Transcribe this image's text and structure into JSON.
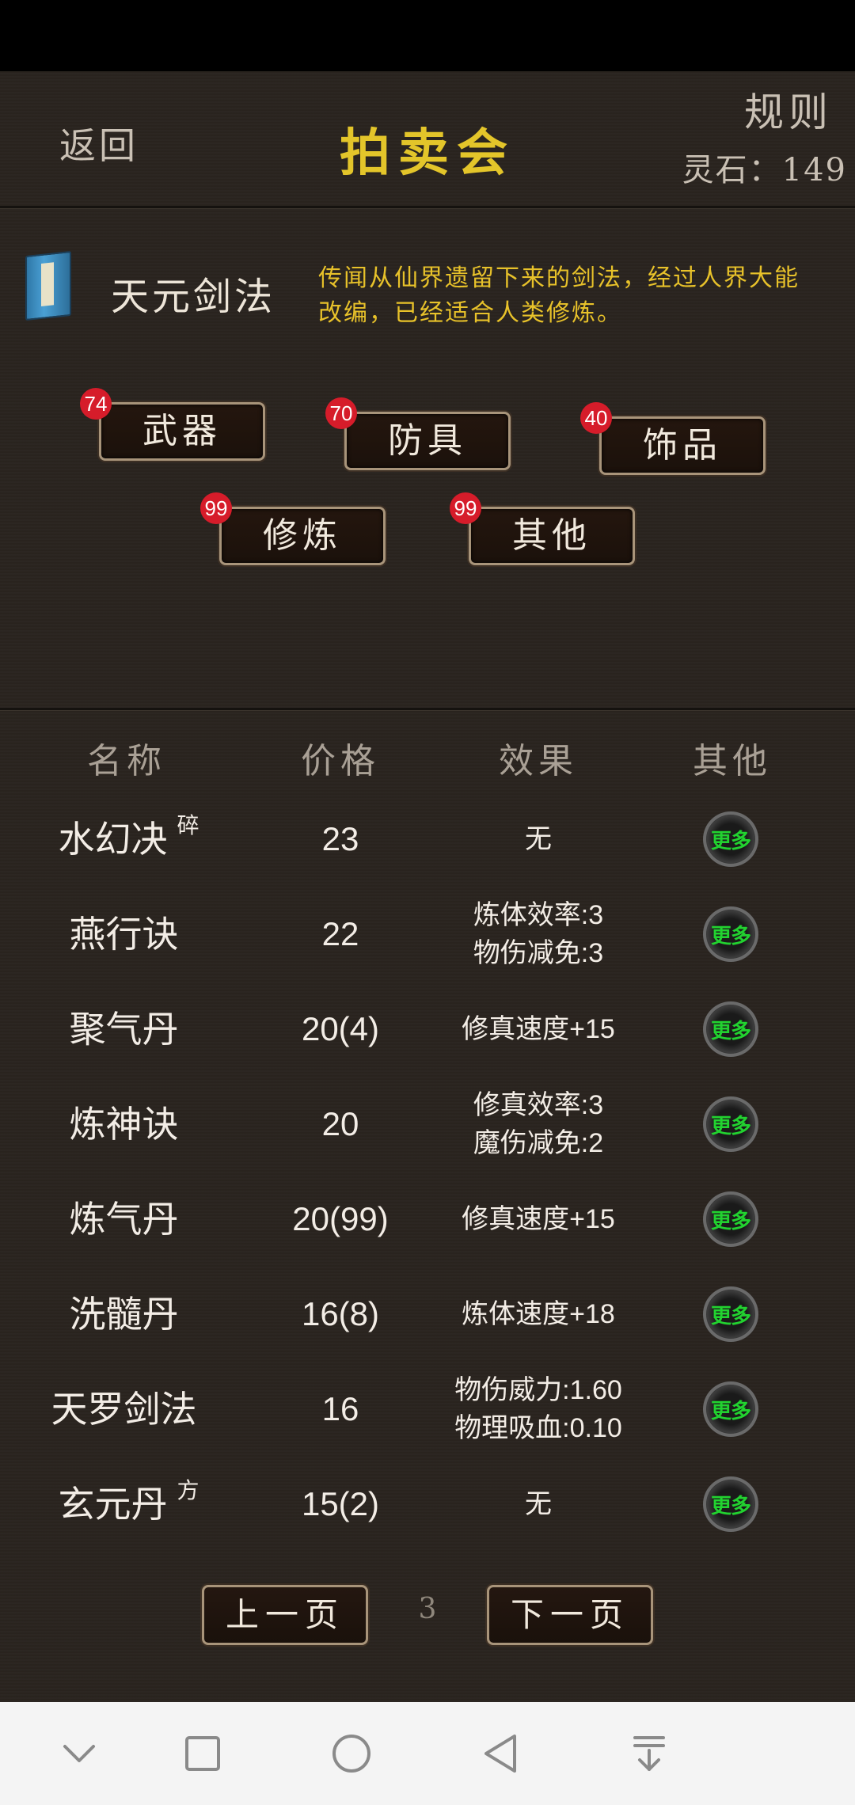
{
  "header": {
    "back_label": "返回",
    "title": "拍卖会",
    "rules_label": "规则",
    "spirit_stones": "灵石：149"
  },
  "featured": {
    "name": "天元剑法",
    "description": "传闻从仙界遗留下来的剑法，经过人界大能改编，已经适合人类修炼。"
  },
  "categories": [
    {
      "label": "武器",
      "count": "74"
    },
    {
      "label": "防具",
      "count": "70"
    },
    {
      "label": "饰品",
      "count": "40"
    },
    {
      "label": "修炼",
      "count": "99"
    },
    {
      "label": "其他",
      "count": "99"
    }
  ],
  "table": {
    "headers": {
      "name": "名称",
      "price": "价格",
      "effect": "效果",
      "other": "其他"
    },
    "more_label": "更多",
    "rows": [
      {
        "name": "水幻决",
        "tag": "碎",
        "price": "23",
        "effect1": "无",
        "effect2": ""
      },
      {
        "name": "燕行诀",
        "tag": "",
        "price": "22",
        "effect1": "炼体效率:3",
        "effect2": "物伤减免:3"
      },
      {
        "name": "聚气丹",
        "tag": "",
        "price": "20(4)",
        "effect1": "修真速度+15",
        "effect2": ""
      },
      {
        "name": "炼神诀",
        "tag": "",
        "price": "20",
        "effect1": "修真效率:3",
        "effect2": "魔伤减免:2"
      },
      {
        "name": "炼气丹",
        "tag": "",
        "price": "20(99)",
        "effect1": "修真速度+15",
        "effect2": ""
      },
      {
        "name": "洗髓丹",
        "tag": "",
        "price": "16(8)",
        "effect1": "炼体速度+18",
        "effect2": ""
      },
      {
        "name": "天罗剑法",
        "tag": "",
        "price": "16",
        "effect1": "物伤威力:1.60",
        "effect2": "物理吸血:0.10"
      },
      {
        "name": "玄元丹",
        "tag": "方",
        "price": "15(2)",
        "effect1": "无",
        "effect2": ""
      }
    ]
  },
  "pager": {
    "prev_label": "上一页",
    "page": "3",
    "next_label": "下一页"
  },
  "colors": {
    "background": "#2a241f",
    "title": "#e3c52a",
    "description": "#e8c22a",
    "badge": "#d61c2a",
    "more_text": "#22d230"
  },
  "navbar": {
    "icons": [
      "chevron-down-icon",
      "square-icon",
      "circle-icon",
      "triangle-back-icon",
      "pull-down-icon"
    ]
  }
}
